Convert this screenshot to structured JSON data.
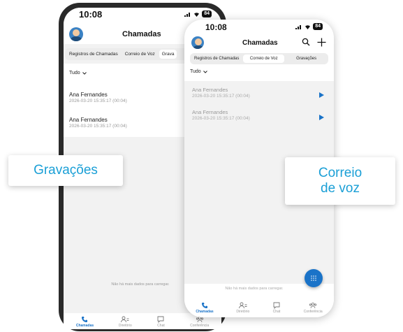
{
  "back": {
    "time": "10:08",
    "battery": "84",
    "title": "Chamadas",
    "title_overflow": "C",
    "tabs": [
      "Registros de Chamadas",
      "Correio de Voz",
      "Grava"
    ],
    "filter": "Tudo",
    "items": [
      {
        "name": "Ana Fernandes",
        "sub": "2026-03-20 15:35:17 (00:04)"
      },
      {
        "name": "Ana Fernandes",
        "sub": "2026-03-20 15:35:17 (00:04)"
      }
    ],
    "no_data": "Não há mais dados para carregar.",
    "nav": [
      "Chamadas",
      "Diretório",
      "Chat",
      "Conferência"
    ]
  },
  "front": {
    "time": "10:08",
    "battery": "84",
    "title": "Chamadas",
    "tabs": [
      "Registros de Chamadas",
      "Correio de Voz",
      "Gravações"
    ],
    "filter": "Tudo",
    "items": [
      {
        "name": "Ana Fernandes",
        "sub": "2026-03-20 15:35:17 (00:04)"
      },
      {
        "name": "Ana Fernandes",
        "sub": "2026-03-20 15:35:17 (00:04)"
      }
    ],
    "no_data": "Não há mais dados para carregar.",
    "nav": [
      "Chamadas",
      "Diretório",
      "Chat",
      "Conferência"
    ]
  },
  "callouts": {
    "left": "Gravações",
    "right_line1": "Correio",
    "right_line2": "de voz"
  },
  "colors": {
    "accent": "#1a73c8",
    "callout_text": "#1a9fd6"
  },
  "icons": [
    "signal-icon",
    "wifi-icon",
    "battery-icon",
    "search-icon",
    "plus-icon",
    "chevron-down-icon",
    "play-icon",
    "dialpad-icon",
    "phone-icon",
    "contacts-icon",
    "chat-icon",
    "conference-icon"
  ]
}
